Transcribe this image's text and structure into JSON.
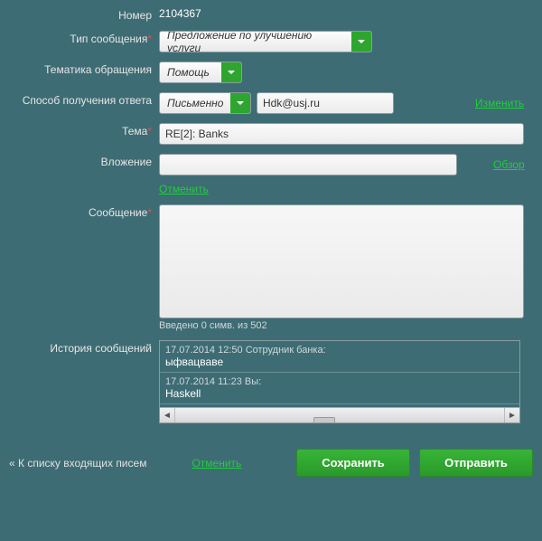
{
  "labels": {
    "number": "Номер",
    "messageType": "Тип сообщения",
    "topic": "Тематика обращения",
    "replyMethod": "Способ получения ответа",
    "subject": "Тема",
    "attachment": "Вложение",
    "message": "Сообщение",
    "history": "История сообщений"
  },
  "values": {
    "number": "2104367",
    "messageType": "Предложение по улучшению услуги",
    "topic": "Помощь",
    "replyMethod": "Письменно",
    "email": "Hdk@usj.ru",
    "subject": "RE[2]: Banks",
    "attachment": ""
  },
  "links": {
    "change": "Изменить",
    "browse": "Обзор",
    "cancel": "Отменить",
    "backToInbox": "« К списку входящих писем"
  },
  "counter": "Введено 0 симв. из 502",
  "history": [
    {
      "header": "17.07.2014 12:50 Сотрудник банка:",
      "body": "ыфвацваве"
    },
    {
      "header": "17.07.2014 11:23 Вы:",
      "body": "Haskell"
    }
  ],
  "buttons": {
    "save": "Сохранить",
    "send": "Отправить"
  }
}
